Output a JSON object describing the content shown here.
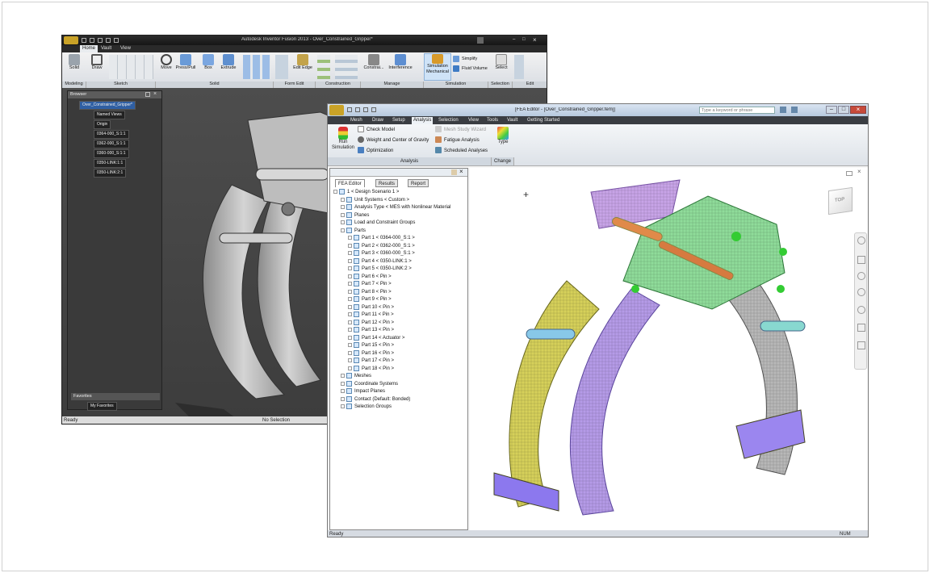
{
  "inventor": {
    "title": "Autodesk Inventor Fusion 2013 - Over_Constrained_Gripper*",
    "tabs": [
      "Home",
      "Vault",
      "View"
    ],
    "ribbon": {
      "solid": "Solid",
      "draw": "Draw",
      "move": "Move",
      "press_pull": "Press/Pull",
      "box": "Box",
      "extrude": "Extrude",
      "edit_edge": "Edit Edge",
      "constrain": "Constrai...",
      "interference": "Interference",
      "simulation_mechanical": "Simulation Mechanical",
      "simplify": "Simplify",
      "fluid_volume": "Fluid Volume",
      "select": "Select",
      "groups": [
        "Modeling",
        "Sketch",
        "Solid",
        "Form Edit",
        "Construction",
        "Manage",
        "Simulation",
        "Selection",
        "Edit"
      ]
    },
    "browser": {
      "title": "Browser",
      "root": "Over_Constrained_Gripper*",
      "items": [
        "Named Views",
        "Origin",
        "0364-000_S:1:1",
        "0362-000_S:1:1",
        "0360-000_S:1:1",
        "0350-LINK:1:1",
        "0350-LINK:2:1"
      ],
      "favorites": "Favorites",
      "my_favorites": "My Favorites"
    },
    "status_left": "Ready",
    "status_center": "No Selection"
  },
  "fea": {
    "title": "[FEA Editor - [Over_Constrained_Gripper.fem]]",
    "search_placeholder": "Type a keyword or phrase",
    "tabs": [
      "Mesh",
      "Draw",
      "Setup",
      "Analysis",
      "Selection",
      "View",
      "Tools",
      "Vault",
      "Getting Started"
    ],
    "active_tab": "Analysis",
    "ribbon": {
      "run_simulation": "Run Simulation",
      "check_model": "Check Model",
      "weight_cg": "Weight and Center of Gravity",
      "optimization": "Optimization",
      "mesh_study": "Mesh Study Wizard",
      "fatigue": "Fatigue Analysis",
      "scheduled": "Scheduled Analyses",
      "type": "Type",
      "group_analysis": "Analysis",
      "group_change": "Change"
    },
    "panel_tabs": [
      "FEA Editor",
      "Results",
      "Report"
    ],
    "tree": [
      {
        "label": "1 < Design Scenario 1 >",
        "level": 0
      },
      {
        "label": "Unit Systems < Custom >",
        "level": 1
      },
      {
        "label": "Analysis Type < MES with Nonlinear Material",
        "level": 1
      },
      {
        "label": "Planes",
        "level": 1
      },
      {
        "label": "Load and Constraint Groups",
        "level": 1
      },
      {
        "label": "Parts",
        "level": 1
      },
      {
        "label": "Part 1 < 0364-000_S:1 >",
        "level": 2
      },
      {
        "label": "Part 2 < 0362-000_S:1 >",
        "level": 2
      },
      {
        "label": "Part 3 < 0360-000_S:1 >",
        "level": 2
      },
      {
        "label": "Part 4 < 0350-LINK:1 >",
        "level": 2
      },
      {
        "label": "Part 5 < 0350-LINK:2 >",
        "level": 2
      },
      {
        "label": "Part 6 < Pin >",
        "level": 2
      },
      {
        "label": "Part 7 < Pin >",
        "level": 2
      },
      {
        "label": "Part 8 < Pin >",
        "level": 2
      },
      {
        "label": "Part 9 < Pin >",
        "level": 2
      },
      {
        "label": "Part 10 < Pin >",
        "level": 2
      },
      {
        "label": "Part 11 < Pin >",
        "level": 2
      },
      {
        "label": "Part 12 < Pin >",
        "level": 2
      },
      {
        "label": "Part 13 < Pin >",
        "level": 2
      },
      {
        "label": "Part 14 < Actuator >",
        "level": 2
      },
      {
        "label": "Part 15 < Pin >",
        "level": 2
      },
      {
        "label": "Part 16 < Pin >",
        "level": 2
      },
      {
        "label": "Part 17 < Pin >",
        "level": 2
      },
      {
        "label": "Part 18 < Pin >",
        "level": 2
      },
      {
        "label": "Meshes",
        "level": 1
      },
      {
        "label": "Coordinate Systems",
        "level": 1
      },
      {
        "label": "Impact Planes",
        "level": 1
      },
      {
        "label": "Contact (Default: Bonded)",
        "level": 1
      },
      {
        "label": "Selection Groups",
        "level": 1
      }
    ],
    "viewcube_label": "TOP",
    "status_left": "Ready",
    "status_right": "NUM"
  }
}
